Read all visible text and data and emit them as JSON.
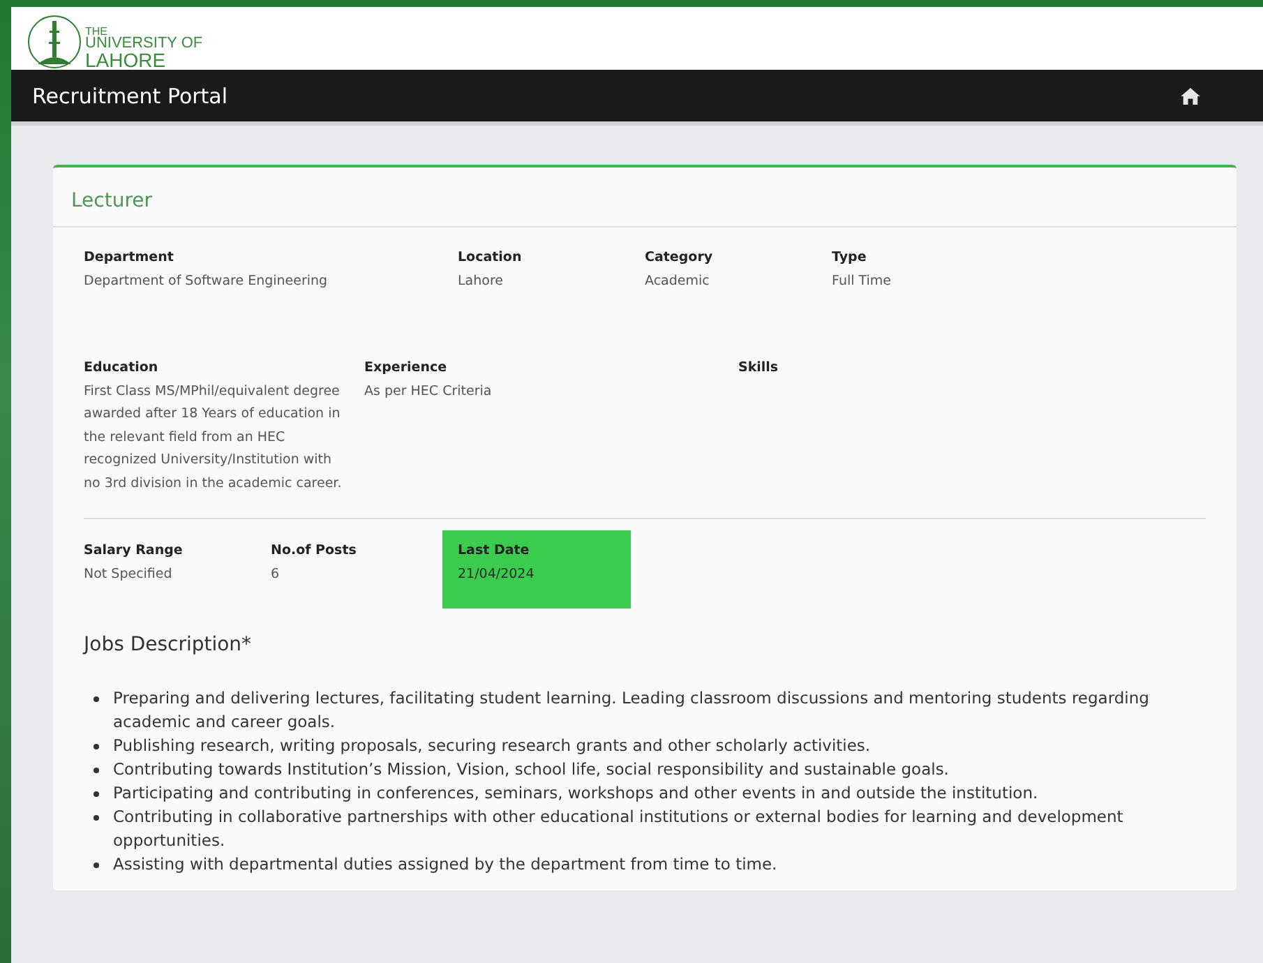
{
  "logo": {
    "lines": [
      "THE",
      "UNIVERSITY OF",
      "LAHORE"
    ]
  },
  "navbar": {
    "title": "Recruitment Portal"
  },
  "job": {
    "title": "Lecturer",
    "field_rows": [
      [
        {
          "label": "Department",
          "value": "Department of Software Engineering",
          "highlighted": false
        },
        {
          "label": "Location",
          "value": "Lahore",
          "highlighted": false
        },
        {
          "label": "Category",
          "value": "Academic",
          "highlighted": false
        },
        {
          "label": "Type",
          "value": "Full Time",
          "highlighted": false
        }
      ],
      [
        {
          "label": "Education",
          "value": "First Class MS/MPhil/equivalent degree awarded after 18 Years of education in the relevant field from an HEC recognized University/Institution with no 3rd division in the academic career.",
          "highlighted": false
        },
        {
          "label": "Experience",
          "value": "As per HEC Criteria",
          "highlighted": false
        },
        {
          "label": "Skills",
          "highlighted": false
        }
      ],
      [
        {
          "label": "Salary Range",
          "value": "Not Specified",
          "highlighted": false
        },
        {
          "label": "No.of Posts",
          "value": "6",
          "highlighted": false
        },
        {
          "label": "Last Date",
          "value": "21/04/2024",
          "highlighted": true
        }
      ]
    ],
    "description_heading": "Jobs Description*",
    "duties": [
      "Preparing and delivering lectures, facilitating student learning. Leading classroom discussions and mentoring students regarding academic and career goals.",
      "Publishing research, writing proposals, securing research grants and other scholarly activities.",
      "Contributing towards Institution’s Mission, Vision, school life, social responsibility and sustainable goals.",
      "Participating and contributing in conferences, seminars, workshops and other events in and outside the institution.",
      "Contributing in collaborative partnerships with other educational institutions or external bodies for learning and development opportunities.",
      "Assisting with departmental duties assigned by the department from time to time."
    ]
  }
}
